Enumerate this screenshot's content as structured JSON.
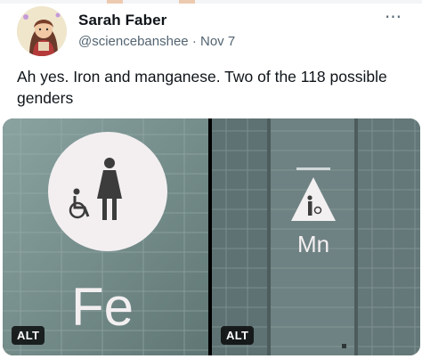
{
  "tweet": {
    "author_name": "Sarah Faber",
    "handle": "@sciencebanshee",
    "separator": "·",
    "date": "Nov 7",
    "more_icon": "more-dots-icon",
    "text": "Ah yes. Iron and manganese. Two of the 118 possible genders"
  },
  "media": {
    "left": {
      "sign_text": "Fe",
      "alt_label": "ALT"
    },
    "right": {
      "sign_text": "Mn",
      "alt_label": "ALT"
    }
  },
  "colors": {
    "text": "#0f1419",
    "secondary": "#536471",
    "tile": "#7f9190",
    "sign": "#f2eef0"
  }
}
